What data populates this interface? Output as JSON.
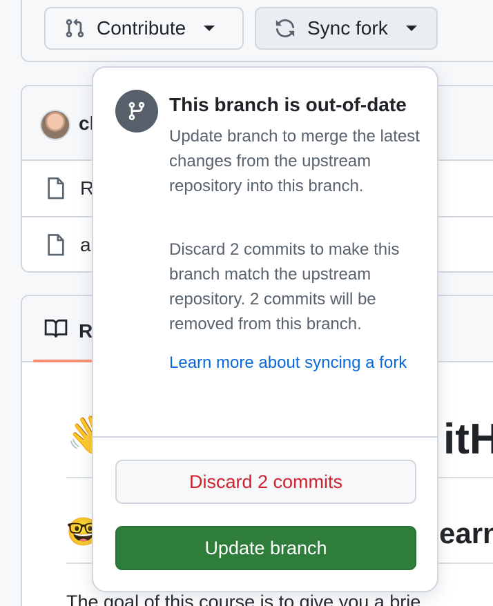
{
  "toolbar": {
    "contribute_label": "Contribute",
    "sync_label": "Sync fork"
  },
  "files": {
    "author_partial": "cl",
    "rows": [
      "R",
      "a"
    ]
  },
  "readme": {
    "tab_label_partial": "R",
    "heading1_partial": "itH",
    "heading2_partial": "earn",
    "body_partial": "The goal of this course is to give you a brie"
  },
  "popover": {
    "title": "This branch is out-of-date",
    "para1": "Update branch to merge the latest changes from the upstream repository into this branch.",
    "para2": "Discard 2 commits to make this branch match the upstream repository. 2 commits will be removed from this branch.",
    "link": "Learn more about syncing a fork",
    "discard_label": "Discard 2 commits",
    "update_label": "Update branch"
  },
  "colors": {
    "danger": "#cf222e",
    "primary": "#2f7d3a",
    "link": "#0969da",
    "muted_text": "#59636e"
  }
}
